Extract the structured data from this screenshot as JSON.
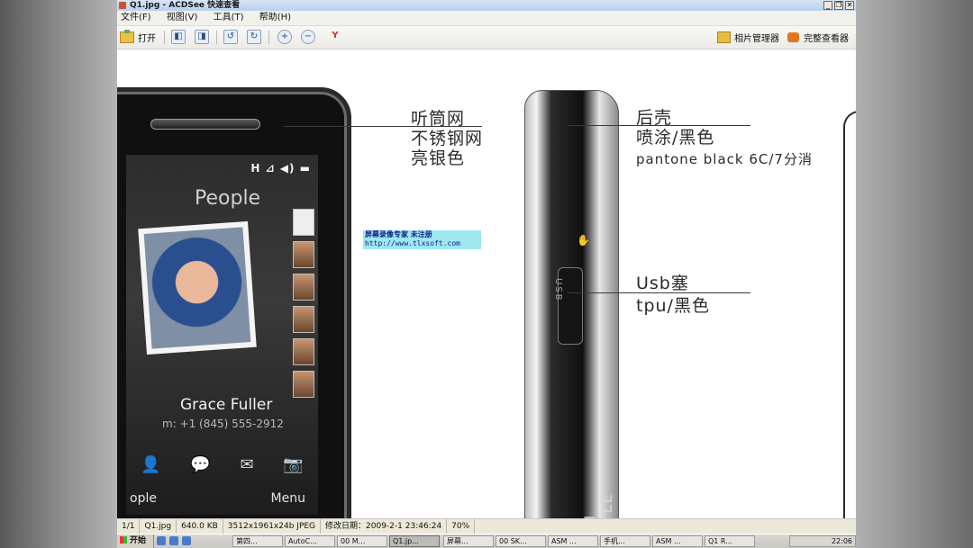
{
  "window": {
    "title": "Q1.jpg - ACDSee 快速查看",
    "buttons": [
      "_",
      "❐",
      "✕"
    ]
  },
  "menu": [
    "文件(F)",
    "视图(V)",
    "工具(T)",
    "帮助(H)"
  ],
  "toolbar": {
    "open_label": "打开",
    "manager_label": "相片管理器",
    "full_viewer_label": "完整查看器"
  },
  "image": {
    "annotations": {
      "earpiece": [
        "听筒网",
        "不锈钢网",
        "亮银色"
      ],
      "back_cover": [
        "后壳",
        "喷涂/黑色",
        "pantone black 6C/7分消"
      ],
      "usb": [
        "Usb塞",
        "tpu/黑色"
      ]
    },
    "watermark": {
      "line1": "屏幕录像专家      未注册",
      "line2": "http://www.tlxsoft.com"
    },
    "phone_screen": {
      "status": "H ⊿ ◀) ▬",
      "title": "People",
      "contact_name": "Grace Fuller",
      "contact_phone": "m: +1 (845) 555-2912",
      "softkey_left": "ople",
      "softkey_right": "Menu"
    },
    "side_text": {
      "usb_port": "USB",
      "brand": "ION STYLE"
    }
  },
  "status_bar": {
    "index": "1/1",
    "filename": "Q1.jpg",
    "size": "640.0 KB",
    "dimensions": "3512x1961x24b JPEG",
    "modified": "修改日期：2009-2-1 23:46:24",
    "zoom": "70%"
  },
  "taskbar": {
    "start_label": "开始",
    "tasks": [
      "第四...",
      "AutoC...",
      "00 M...",
      "Q1.jp...",
      "屏幕...",
      "00 SK...",
      "ASM ...",
      "手机...",
      "ASM ...",
      "Q1 R..."
    ],
    "clock": "22:06"
  }
}
